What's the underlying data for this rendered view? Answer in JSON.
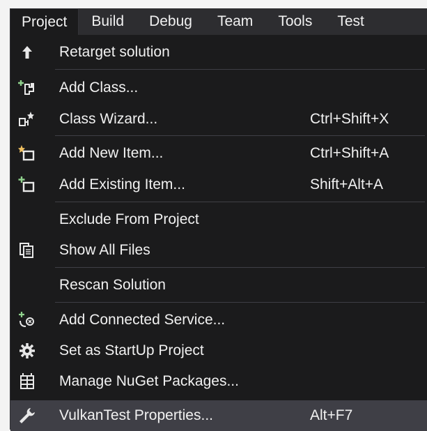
{
  "menubar": {
    "items": [
      "Project",
      "Build",
      "Debug",
      "Team",
      "Tools",
      "Test"
    ]
  },
  "dropdown": {
    "items": [
      {
        "label": "Retarget solution",
        "shortcut": "",
        "icon": "up-arrow-icon"
      },
      {
        "label": "Add Class...",
        "shortcut": "",
        "icon": "add-class-icon"
      },
      {
        "label": "Class Wizard...",
        "shortcut": "Ctrl+Shift+X",
        "icon": "class-wizard-icon"
      },
      {
        "label": "Add New Item...",
        "shortcut": "Ctrl+Shift+A",
        "icon": "add-new-item-icon"
      },
      {
        "label": "Add Existing Item...",
        "shortcut": "Shift+Alt+A",
        "icon": "add-existing-item-icon"
      },
      {
        "label": "Exclude From Project",
        "shortcut": "",
        "icon": ""
      },
      {
        "label": "Show All Files",
        "shortcut": "",
        "icon": "show-all-files-icon"
      },
      {
        "label": "Rescan Solution",
        "shortcut": "",
        "icon": ""
      },
      {
        "label": "Add Connected Service...",
        "shortcut": "",
        "icon": "connected-service-icon"
      },
      {
        "label": "Set as StartUp Project",
        "shortcut": "",
        "icon": "gear-icon"
      },
      {
        "label": "Manage NuGet Packages...",
        "shortcut": "",
        "icon": "nuget-icon"
      },
      {
        "label": "VulkanTest Properties...",
        "shortcut": "Alt+F7",
        "icon": "wrench-icon"
      }
    ]
  },
  "colors": {
    "menu_background": "#1b1b1c",
    "menubar_background": "#2d2d30",
    "highlight": "#3f3f46",
    "text": "#f1f1f1",
    "icon_accent": "#8fd18c"
  }
}
